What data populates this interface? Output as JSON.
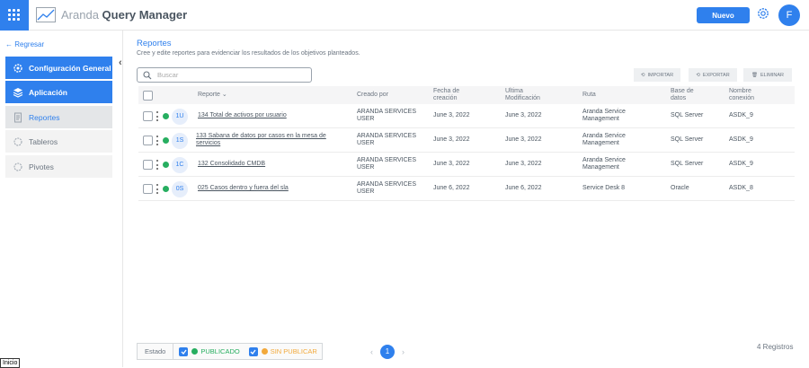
{
  "app": {
    "brand_light": "Aranda",
    "brand_bold": "Query Manager",
    "new_button": "Nuevo",
    "user_initial": "F"
  },
  "sidebar": {
    "back": "Regresar",
    "items": [
      {
        "label": "Configuración General"
      },
      {
        "label": "Aplicación"
      },
      {
        "label": "Reportes"
      },
      {
        "label": "Tableros"
      },
      {
        "label": "Pivotes"
      }
    ]
  },
  "page": {
    "title": "Reportes",
    "subtitle": "Cree y edite reportes para evidenciar los resultados de los objetivos planteados.",
    "search_placeholder": "Buscar",
    "actions": {
      "import": "IMPORTAR",
      "export": "EXPORTAR",
      "delete": "ELIMINAR"
    }
  },
  "table": {
    "headers": {
      "report": "Reporte",
      "created_by": "Creado por",
      "created_date_1": "Fecha de",
      "created_date_2": "creación",
      "modified_1": "Ultima",
      "modified_2": "Modificación",
      "route": "Ruta",
      "db_1": "Base de",
      "db_2": "datos",
      "conn_1": "Nombre",
      "conn_2": "conexión"
    },
    "rows": [
      {
        "badge": "1U",
        "name_1": "134 Total de activos por usuario",
        "name_2": "",
        "creator_1": "ARANDA SERVICES",
        "creator_2": "USER",
        "created": "June 3, 2022",
        "modified": "June 3, 2022",
        "route_1": "Aranda Service",
        "route_2": "Management",
        "db": "SQL Server",
        "conn": "ASDK_9"
      },
      {
        "badge": "1S",
        "name_1": "133 Sabana de datos por casos en la mesa de",
        "name_2": "servicios",
        "creator_1": "ARANDA SERVICES",
        "creator_2": "USER",
        "created": "June 3, 2022",
        "modified": "June 3, 2022",
        "route_1": "Aranda Service",
        "route_2": "Management",
        "db": "SQL Server",
        "conn": "ASDK_9"
      },
      {
        "badge": "1C",
        "name_1": "132 Consolidado CMDB",
        "name_2": "",
        "creator_1": "ARANDA SERVICES",
        "creator_2": "USER",
        "created": "June 3, 2022",
        "modified": "June 3, 2022",
        "route_1": "Aranda Service",
        "route_2": "Management",
        "db": "SQL Server",
        "conn": "ASDK_9"
      },
      {
        "badge": "0S",
        "name_1": "025 Casos dentro y fuera del sla",
        "name_2": "",
        "creator_1": "ARANDA SERVICES",
        "creator_2": "USER",
        "created": "June 6, 2022",
        "modified": "June 6, 2022",
        "route_1": "Service Desk 8",
        "route_2": "",
        "db": "Oracle",
        "conn": "ASDK_8"
      }
    ]
  },
  "footer": {
    "state_label": "Estado",
    "published": "PUBLICADO",
    "unpublished": "SIN PUBLICAR",
    "page": "1",
    "count": "4 Registros"
  },
  "taskbar": {
    "start": "Inicio"
  },
  "colors": {
    "accent": "#2f80ed",
    "published": "#27ae60",
    "unpublished": "#f2a93b"
  }
}
